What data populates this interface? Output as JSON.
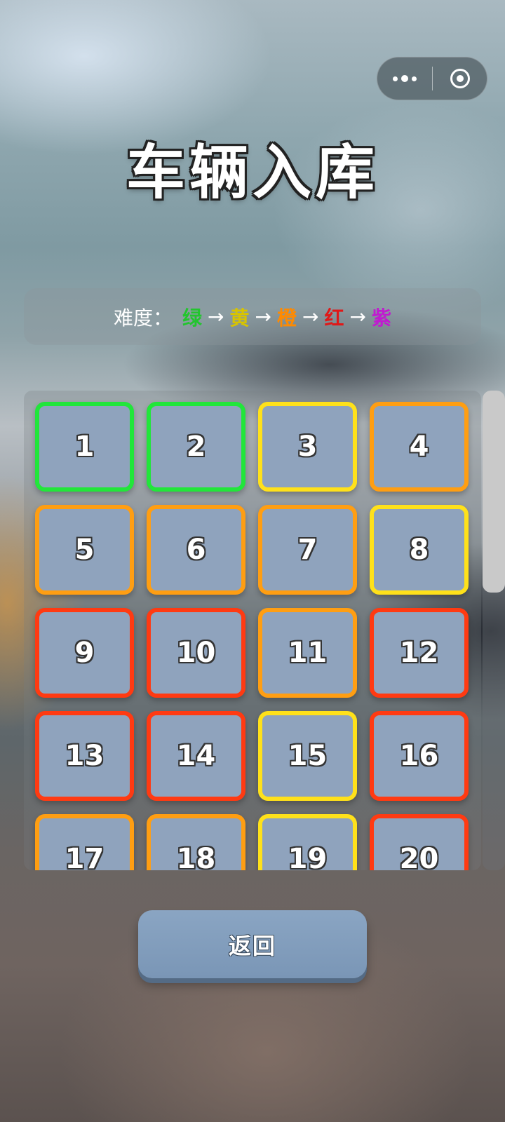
{
  "header": {
    "title": "车辆入库"
  },
  "capsule": {
    "more_icon": "more-dots-icon",
    "close_icon": "target-circle-icon"
  },
  "difficulty": {
    "label": "难度：",
    "arrow": "→",
    "levels": [
      {
        "name": "绿",
        "color": "#22c52e"
      },
      {
        "name": "黄",
        "color": "#d8c400"
      },
      {
        "name": "橙",
        "color": "#ff8a00"
      },
      {
        "name": "红",
        "color": "#e01818"
      },
      {
        "name": "紫",
        "color": "#c11ad0"
      }
    ]
  },
  "level_colors": {
    "green": "#21e63a",
    "yellow": "#ffe11a",
    "orange": "#ff9e12",
    "red": "#ff3a12"
  },
  "levels": [
    {
      "number": "1",
      "difficulty": "green"
    },
    {
      "number": "2",
      "difficulty": "green"
    },
    {
      "number": "3",
      "difficulty": "yellow"
    },
    {
      "number": "4",
      "difficulty": "orange"
    },
    {
      "number": "5",
      "difficulty": "orange"
    },
    {
      "number": "6",
      "difficulty": "orange"
    },
    {
      "number": "7",
      "difficulty": "orange"
    },
    {
      "number": "8",
      "difficulty": "yellow"
    },
    {
      "number": "9",
      "difficulty": "red"
    },
    {
      "number": "10",
      "difficulty": "red"
    },
    {
      "number": "11",
      "difficulty": "orange"
    },
    {
      "number": "12",
      "difficulty": "red"
    },
    {
      "number": "13",
      "difficulty": "red"
    },
    {
      "number": "14",
      "difficulty": "red"
    },
    {
      "number": "15",
      "difficulty": "yellow"
    },
    {
      "number": "16",
      "difficulty": "red"
    },
    {
      "number": "17",
      "difficulty": "orange"
    },
    {
      "number": "18",
      "difficulty": "orange"
    },
    {
      "number": "19",
      "difficulty": "yellow"
    },
    {
      "number": "20",
      "difficulty": "red"
    }
  ],
  "back_button": {
    "label": "返回"
  }
}
